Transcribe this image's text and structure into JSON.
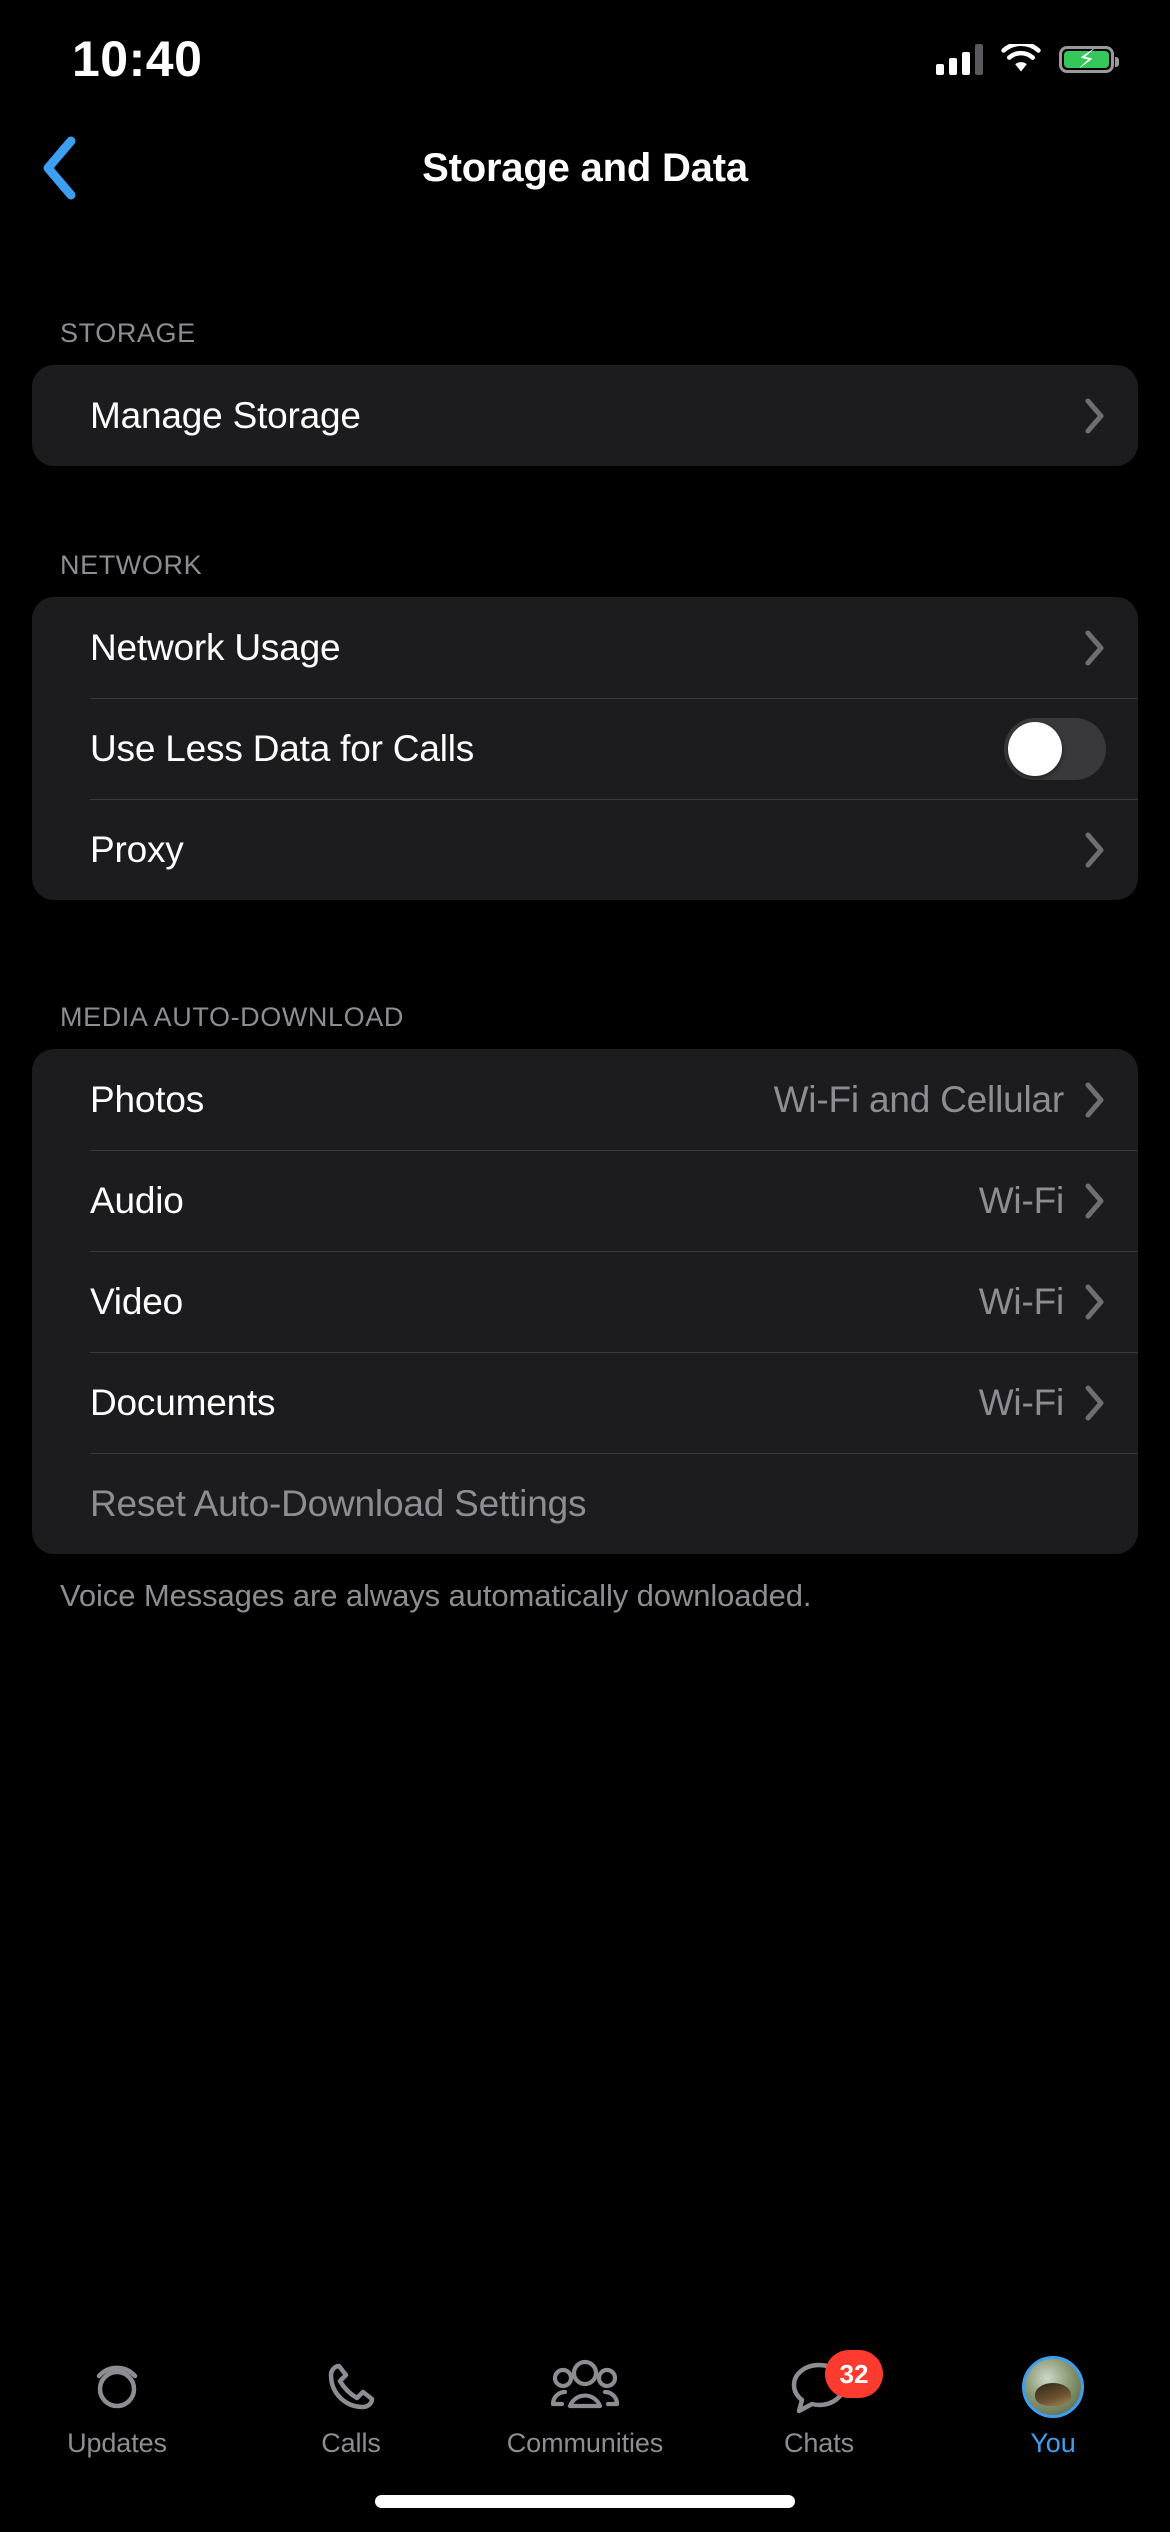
{
  "status_bar": {
    "time": "10:40",
    "cellular_icon": "cellular-signal-icon",
    "wifi_icon": "wifi-icon",
    "battery_icon": "battery-charging-icon",
    "battery_color": "#35c759"
  },
  "header": {
    "title": "Storage and Data",
    "back_icon": "chevron-left-icon",
    "back_color": "#3e9ff0"
  },
  "sections": [
    {
      "header": "STORAGE",
      "rows": [
        {
          "label": "Manage Storage",
          "value": "",
          "accessory": "chevron"
        }
      ]
    },
    {
      "header": "NETWORK",
      "rows": [
        {
          "label": "Network Usage",
          "value": "",
          "accessory": "chevron"
        },
        {
          "label": "Use Less Data for Calls",
          "value": "",
          "accessory": "toggle",
          "toggle_on": false
        },
        {
          "label": "Proxy",
          "value": "",
          "accessory": "chevron"
        }
      ]
    },
    {
      "header": "MEDIA AUTO-DOWNLOAD",
      "rows": [
        {
          "label": "Photos",
          "value": "Wi-Fi and Cellular",
          "accessory": "chevron"
        },
        {
          "label": "Audio",
          "value": "Wi-Fi",
          "accessory": "chevron"
        },
        {
          "label": "Video",
          "value": "Wi-Fi",
          "accessory": "chevron"
        },
        {
          "label": "Documents",
          "value": "Wi-Fi",
          "accessory": "chevron"
        },
        {
          "label": "Reset Auto-Download Settings",
          "value": "",
          "accessory": "none",
          "muted": true
        }
      ],
      "footnote": "Voice Messages are always automatically downloaded."
    }
  ],
  "tab_bar": {
    "active_color": "#3e9ff0",
    "inactive_color": "#8d8d93",
    "tabs": [
      {
        "label": "Updates",
        "icon": "updates-status-icon",
        "active": false,
        "badge": ""
      },
      {
        "label": "Calls",
        "icon": "phone-icon",
        "active": false,
        "badge": ""
      },
      {
        "label": "Communities",
        "icon": "communities-people-icon",
        "active": false,
        "badge": ""
      },
      {
        "label": "Chats",
        "icon": "chat-bubble-icon",
        "active": false,
        "badge": "32"
      },
      {
        "label": "You",
        "icon": "profile-avatar-icon",
        "active": true,
        "badge": ""
      }
    ]
  }
}
